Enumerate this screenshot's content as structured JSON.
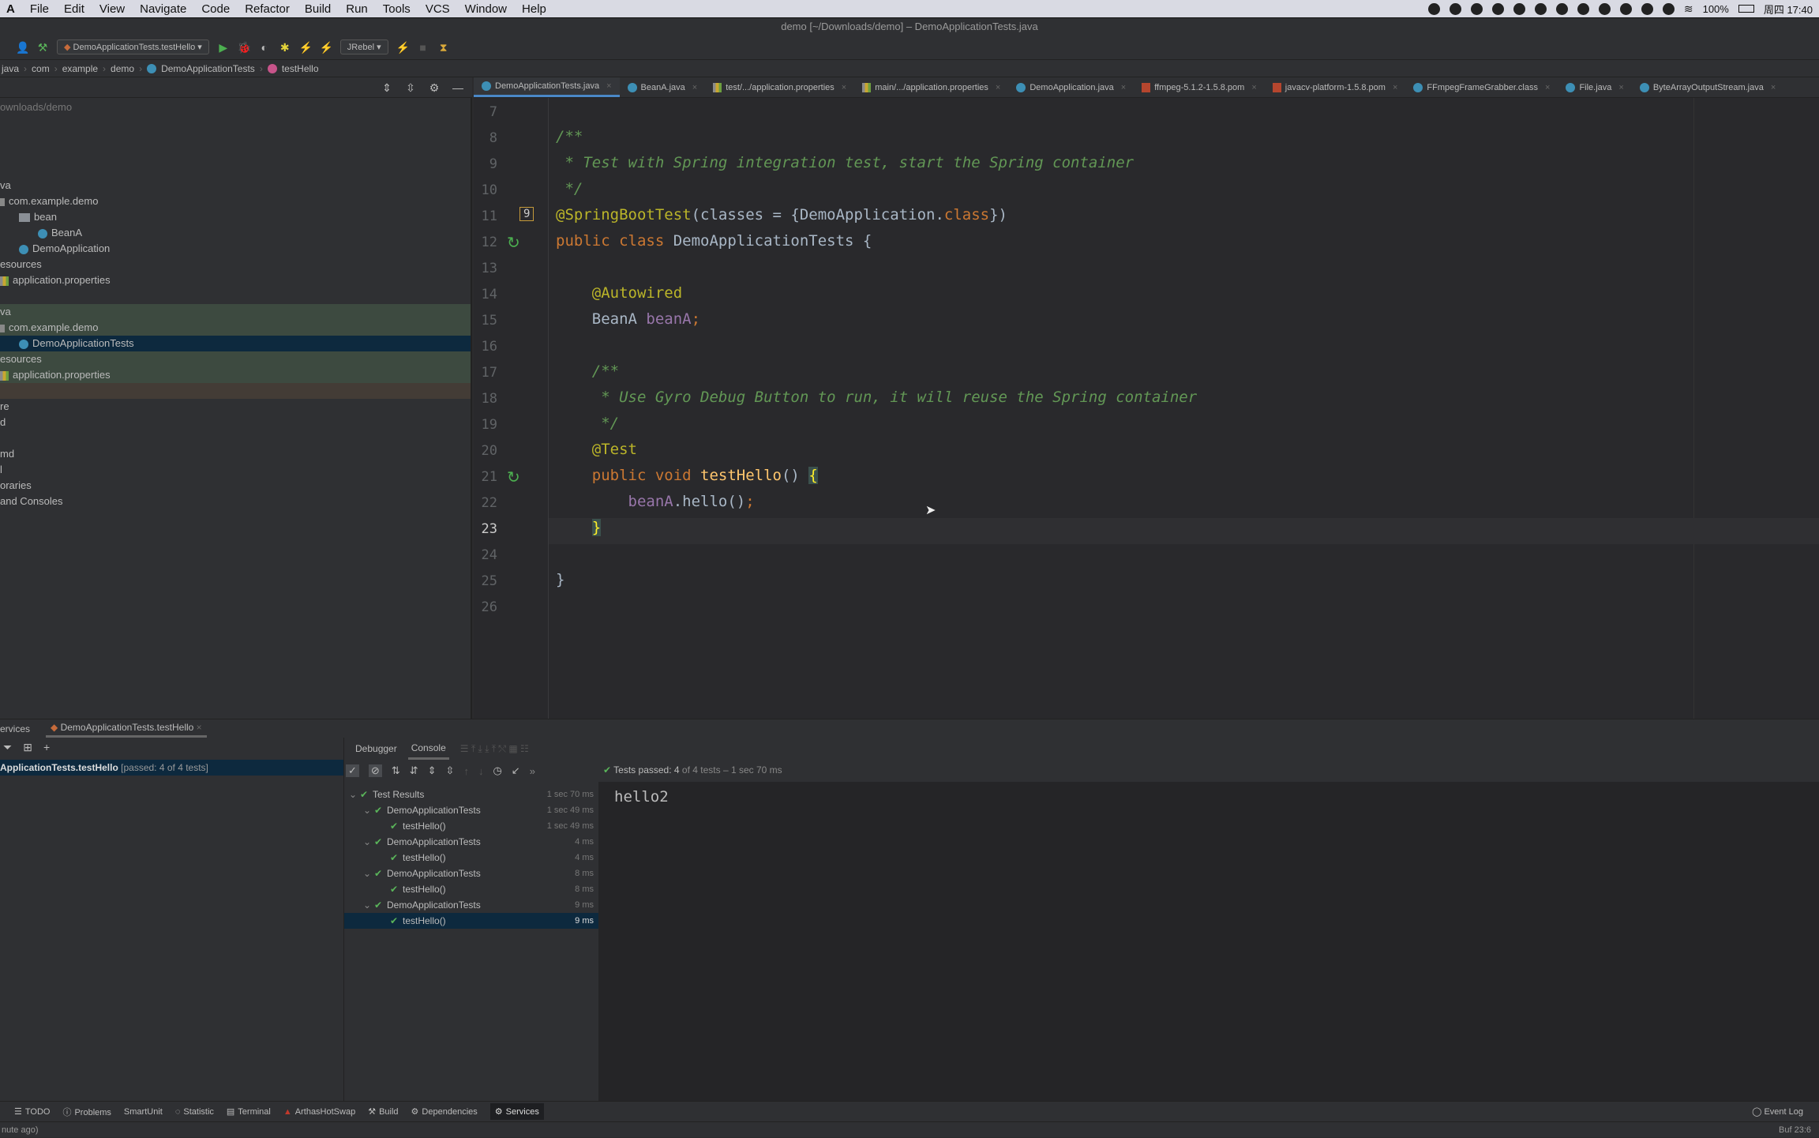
{
  "menubar": {
    "app": "A",
    "items": [
      "File",
      "Edit",
      "View",
      "Navigate",
      "Code",
      "Refactor",
      "Build",
      "Run",
      "Tools",
      "VCS",
      "Window",
      "Help"
    ],
    "battery": "100%",
    "clock": "周四 17:40"
  },
  "title": "demo [~/Downloads/demo] – DemoApplicationTests.java",
  "toolbar": {
    "run_config": "DemoApplicationTests.testHello",
    "jrebel": "JRebel"
  },
  "breadcrumb": [
    "java",
    "com",
    "example",
    "demo",
    "DemoApplicationTests",
    "testHello"
  ],
  "tabs": [
    {
      "label": "DemoApplicationTests.java",
      "icon": "class-icon",
      "active": true
    },
    {
      "label": "BeanA.java",
      "icon": "class-icon"
    },
    {
      "label": "test/.../application.properties",
      "icon": "properties-icon"
    },
    {
      "label": "main/.../application.properties",
      "icon": "properties-icon"
    },
    {
      "label": "DemoApplication.java",
      "icon": "class-icon"
    },
    {
      "label": "ffmpeg-5.1.2-1.5.8.pom",
      "icon": "maven-icon"
    },
    {
      "label": "javacv-platform-1.5.8.pom",
      "icon": "maven-icon"
    },
    {
      "label": "FFmpegFrameGrabber.class",
      "icon": "class-icon"
    },
    {
      "label": "File.java",
      "icon": "class-icon"
    },
    {
      "label": "ByteArrayOutputStream.java",
      "icon": "class-icon"
    }
  ],
  "project": {
    "path": "ownloads/demo",
    "rows": [
      {
        "label": "va",
        "indent": 0
      },
      {
        "label": "com.example.demo",
        "indent": 0,
        "icon": "package-icon"
      },
      {
        "label": "bean",
        "indent": 1,
        "icon": "folder-icon"
      },
      {
        "label": "BeanA",
        "indent": 2,
        "icon": "class-icon"
      },
      {
        "label": "DemoApplication",
        "indent": 1,
        "icon": "class-icon"
      },
      {
        "label": "esources",
        "indent": 0
      },
      {
        "label": "application.properties",
        "indent": 0,
        "icon": "properties-icon"
      },
      {
        "label": "",
        "indent": 0
      },
      {
        "label": "va",
        "indent": 0,
        "hl": "test"
      },
      {
        "label": "com.example.demo",
        "indent": 0,
        "icon": "package-icon",
        "hl": "test"
      },
      {
        "label": "DemoApplicationTests",
        "indent": 1,
        "icon": "class-icon",
        "hl": "sel"
      },
      {
        "label": "esources",
        "indent": 0,
        "hl": "test"
      },
      {
        "label": "application.properties",
        "indent": 0,
        "icon": "properties-icon",
        "hl": "test"
      },
      {
        "label": "",
        "indent": 0,
        "hl": "excl"
      },
      {
        "label": "re",
        "indent": 0
      },
      {
        "label": "d",
        "indent": 0
      },
      {
        "label": "",
        "indent": 0
      },
      {
        "label": "md",
        "indent": 0
      },
      {
        "label": "l",
        "indent": 0
      },
      {
        "label": "oraries",
        "indent": 0
      },
      {
        "label": "and Consoles",
        "indent": 0
      }
    ]
  },
  "editor": {
    "lines": [
      {
        "n": "7",
        "tokens": []
      },
      {
        "n": "8",
        "tokens": [
          {
            "t": "/**",
            "c": "cm"
          }
        ]
      },
      {
        "n": "9",
        "tokens": [
          {
            "t": " * Test with Spring integration test, start the Spring container",
            "c": "cm"
          }
        ]
      },
      {
        "n": "10",
        "tokens": [
          {
            "t": " */",
            "c": "cm"
          }
        ]
      },
      {
        "n": "11",
        "tokens": [
          {
            "t": "@SpringBootTest",
            "c": "an"
          },
          {
            "t": "(classes = {DemoApplication.",
            "c": ""
          },
          {
            "t": "class",
            "c": "kw"
          },
          {
            "t": "})",
            "c": ""
          }
        ],
        "badge": "9"
      },
      {
        "n": "12",
        "tokens": [
          {
            "t": "public class ",
            "c": "kw"
          },
          {
            "t": "DemoApplicationTests {",
            "c": ""
          }
        ],
        "run": true
      },
      {
        "n": "13",
        "tokens": []
      },
      {
        "n": "14",
        "tokens": [
          {
            "t": "    @Autowired",
            "c": "an"
          }
        ]
      },
      {
        "n": "15",
        "tokens": [
          {
            "t": "    BeanA ",
            "c": ""
          },
          {
            "t": "beanA",
            "c": "fd"
          },
          {
            "t": ";",
            "c": "kw"
          }
        ]
      },
      {
        "n": "16",
        "tokens": []
      },
      {
        "n": "17",
        "tokens": [
          {
            "t": "    /**",
            "c": "cm"
          }
        ]
      },
      {
        "n": "18",
        "tokens": [
          {
            "t": "     * Use Gyro Debug Button to run, it will reuse the Spring container",
            "c": "cm"
          }
        ]
      },
      {
        "n": "19",
        "tokens": [
          {
            "t": "     */",
            "c": "cm"
          }
        ]
      },
      {
        "n": "20",
        "tokens": [
          {
            "t": "    @Test",
            "c": "an"
          }
        ]
      },
      {
        "n": "21",
        "tokens": [
          {
            "t": "    public void ",
            "c": "kw"
          },
          {
            "t": "testHello",
            "c": "md"
          },
          {
            "t": "() ",
            "c": ""
          },
          {
            "t": "{",
            "c": "br"
          }
        ],
        "run": true
      },
      {
        "n": "22",
        "tokens": [
          {
            "t": "        ",
            "c": ""
          },
          {
            "t": "beanA",
            "c": "fd"
          },
          {
            "t": ".hello()",
            "c": ""
          },
          {
            "t": ";",
            "c": "kw"
          }
        ]
      },
      {
        "n": "23",
        "tokens": [
          {
            "t": "    ",
            "c": ""
          },
          {
            "t": "}",
            "c": "br"
          }
        ],
        "current": true
      },
      {
        "n": "24",
        "tokens": []
      },
      {
        "n": "25",
        "tokens": [
          {
            "t": "}",
            "c": ""
          }
        ]
      },
      {
        "n": "26",
        "tokens": []
      }
    ]
  },
  "services": {
    "tab_left": "ervices",
    "tab_run": "DemoApplicationTests.testHello",
    "node": "ApplicationTests.testHello",
    "node_status": "[passed: 4 of 4 tests]"
  },
  "runtabs": {
    "debugger": "Debugger",
    "console": "Console"
  },
  "status_summary": {
    "label": "Tests passed:",
    "count": "4",
    "rest": "of 4 tests – 1 sec 70 ms"
  },
  "tests": [
    {
      "label": "Test Results",
      "level": 0,
      "time": "1 sec 70 ms",
      "chev": true
    },
    {
      "label": "DemoApplicationTests",
      "level": 1,
      "time": "1 sec 49 ms",
      "chev": true
    },
    {
      "label": "testHello()",
      "level": 2,
      "time": "1 sec 49 ms"
    },
    {
      "label": "DemoApplicationTests",
      "level": 1,
      "time": "4 ms",
      "chev": true
    },
    {
      "label": "testHello()",
      "level": 2,
      "time": "4 ms"
    },
    {
      "label": "DemoApplicationTests",
      "level": 1,
      "time": "8 ms",
      "chev": true
    },
    {
      "label": "testHello()",
      "level": 2,
      "time": "8 ms"
    },
    {
      "label": "DemoApplicationTests",
      "level": 1,
      "time": "9 ms",
      "chev": true
    },
    {
      "label": "testHello()",
      "level": 2,
      "time": "9 ms",
      "selected": true
    }
  ],
  "console_output": "hello2",
  "toolstrip": [
    "TODO",
    "Problems",
    "SmartUnit",
    "Statistic",
    "Terminal",
    "ArthasHotSwap",
    "Build",
    "Dependencies",
    "Services"
  ],
  "toolstrip_active": "Services",
  "event_log": "Event Log",
  "statusbar": {
    "left": "nute ago)",
    "right": "Buf  23:6"
  },
  "colors": {
    "accent": "#4a88c7",
    "comment": "#629755",
    "keyword": "#cc7832",
    "annotation": "#bbb529",
    "pass": "#5ab55a"
  }
}
